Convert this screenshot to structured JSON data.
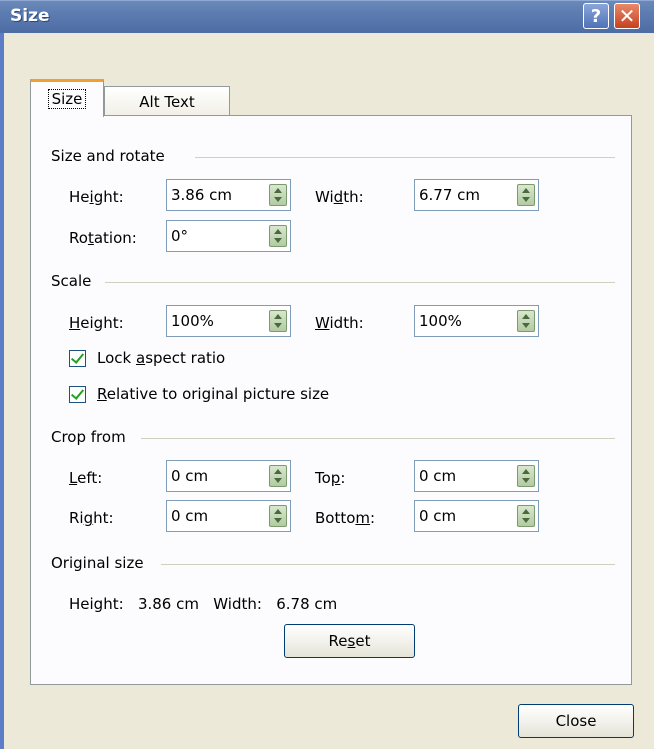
{
  "window": {
    "title": "Size",
    "help": "?",
    "close_glyph": "✕"
  },
  "tabs": [
    {
      "label": "Size"
    },
    {
      "label": "Alt Text"
    }
  ],
  "size_rotate": {
    "heading": "Size and rotate",
    "height_label": [
      "He",
      "i",
      "ght:"
    ],
    "height_value": "3.86 cm",
    "width_label": [
      "Wi",
      "d",
      "th:"
    ],
    "width_value": "6.77 cm",
    "rotation_label": [
      "Ro",
      "t",
      "ation:"
    ],
    "rotation_value": "0°"
  },
  "scale": {
    "heading": "Scale",
    "height_label": [
      "",
      "H",
      "eight:"
    ],
    "height_value": "100%",
    "width_label": [
      "",
      "W",
      "idth:"
    ],
    "width_value": "100%",
    "lock_label": [
      "Lock ",
      "a",
      "spect ratio"
    ],
    "lock_checked": true,
    "relative_label": [
      "",
      "R",
      "elative to original picture size"
    ],
    "relative_checked": true
  },
  "crop": {
    "heading": "Crop from",
    "left_label": [
      "",
      "L",
      "eft:"
    ],
    "left_value": "0 cm",
    "top_label": [
      "To",
      "p",
      ":"
    ],
    "top_value": "0 cm",
    "right_label": [
      "Ri",
      "g",
      "ht:"
    ],
    "right_value": "0 cm",
    "bottom_label": [
      "Botto",
      "m",
      ":"
    ],
    "bottom_value": "0 cm"
  },
  "original": {
    "heading": "Original size",
    "summary": "Height:   3.86 cm   Width:   6.78 cm",
    "reset_label": [
      "Re",
      "s",
      "et"
    ]
  },
  "footer": {
    "close_label": "Close"
  },
  "colors": {
    "title_bar": "#5a7ab0",
    "dialog_bg": "#ece9d8",
    "panel_bg": "#fcfcfe",
    "tab_accent": "#f0a030"
  }
}
